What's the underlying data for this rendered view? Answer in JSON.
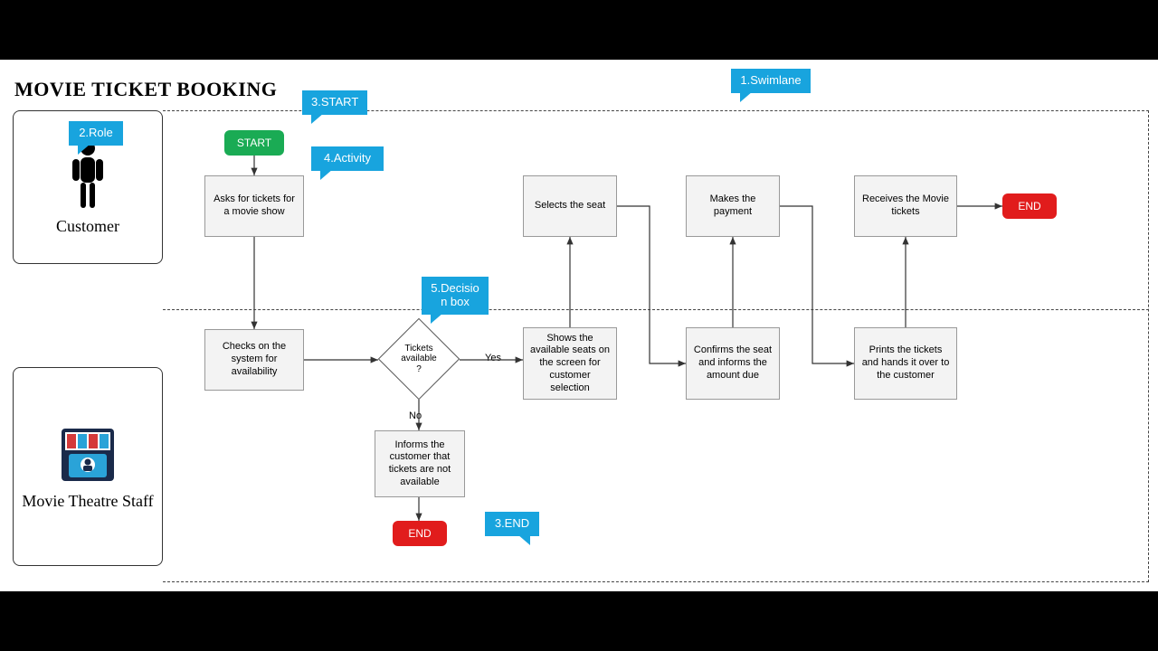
{
  "title": "MOVIE TICKET BOOKING",
  "roles": {
    "customer": "Customer",
    "staff": "Movie Theatre Staff"
  },
  "callouts": {
    "swimlane": "1.Swimlane",
    "role": "2.Role",
    "start": "3.START",
    "end": "3.END",
    "activity": "4.Activity",
    "decision": "5.Decisio n box"
  },
  "nodes": {
    "start": "START",
    "end1": "END",
    "end2": "END",
    "ask": "Asks for tickets for a movie show",
    "check": "Checks on the system for availability",
    "decision": "Tickets available ?",
    "inform_na": "Informs the customer that tickets are not available",
    "show_seats": "Shows the available seats on the screen for customer selection",
    "select_seat": "Selects the seat",
    "confirm": "Confirms the seat and informs the amount due",
    "pay": "Makes the payment",
    "print": "Prints the tickets and hands it over to the customer",
    "receive": "Receives the Movie tickets"
  },
  "edge_labels": {
    "yes": "Yes",
    "no": "No"
  }
}
